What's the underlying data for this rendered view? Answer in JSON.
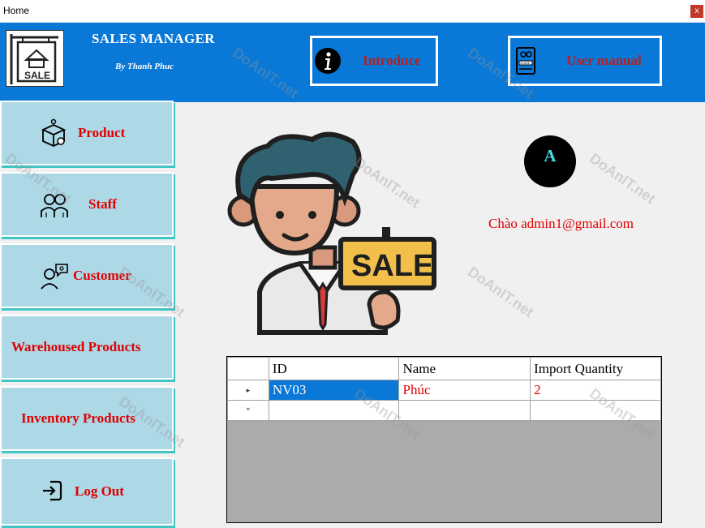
{
  "window": {
    "title": "Home",
    "close_label": "x"
  },
  "header": {
    "title": "SALES MANAGER",
    "subtitle": "By Thanh Phuc",
    "logo_text": "SALE",
    "introduce_label": "Introduce",
    "manual_label": "User manual",
    "manual_icon_text": "GUIDE"
  },
  "sidebar": {
    "items": [
      {
        "label": "Product",
        "icon": "product-box-icon"
      },
      {
        "label": "Staff",
        "icon": "staff-people-icon"
      },
      {
        "label": "Customer",
        "icon": "customer-icon"
      },
      {
        "label": "Warehoused Products"
      },
      {
        "label": "Inventory Products"
      },
      {
        "label": "Log Out",
        "icon": "logout-icon"
      }
    ]
  },
  "main": {
    "illustration_sign": "SALE",
    "avatar_letter": "A",
    "greeting": "Chào admin1@gmail.com"
  },
  "grid": {
    "columns": [
      "ID",
      "Name",
      "Import Quantity"
    ],
    "rows": [
      {
        "id": "NV03",
        "name": "Phúc",
        "qty": "2"
      }
    ],
    "new_row_marker": "*",
    "current_row_marker": "▸"
  },
  "watermark": "DoAnIT.net",
  "colors": {
    "header": "#0a78d7",
    "nav_button": "#add8e6",
    "accent_red": "#e00000",
    "selection": "#0a78d7"
  }
}
